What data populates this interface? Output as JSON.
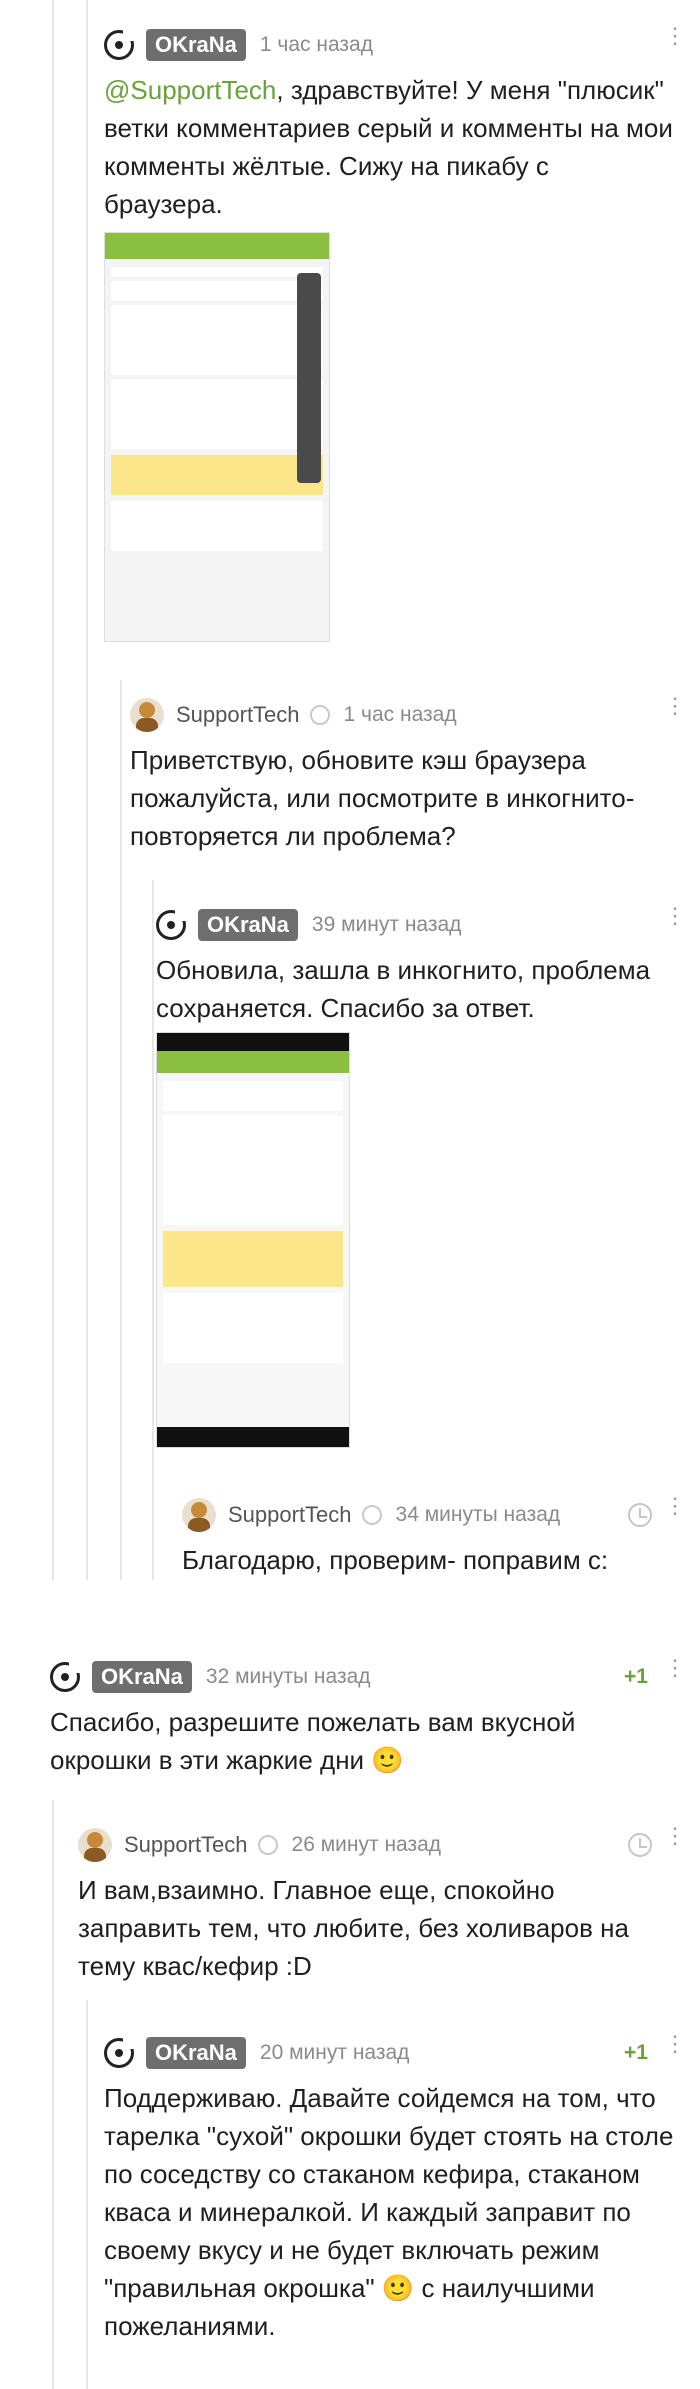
{
  "comments": [
    {
      "author": "OKraNa",
      "time": "1 час назад",
      "mention": "@SupportTech",
      "text": ", здравствуйте! У меня \"плюсик\" ветки комментариев серый и комменты на мои комменты жёлтые. Сижу на пикабу с браузера."
    },
    {
      "author": "SupportTech",
      "time": "1 час назад",
      "text": "Приветствую, обновите кэш браузера пожалуйста, или посмотрите в инкогнито- повторяется ли проблема?"
    },
    {
      "author": "OKraNa",
      "time": "39 минут назад",
      "text": "Обновила, зашла в инкогнито, проблема сохраняется. Спасибо за ответ."
    },
    {
      "author": "SupportTech",
      "time": "34 минуты назад",
      "text": "Благодарю, проверим- поправим с:"
    },
    {
      "author": "OKraNa",
      "time": "32 минуты назад",
      "rating": "+1",
      "text": "Спасибо, разрешите пожелать вам вкусной окрошки в эти жаркие дни 🙂"
    },
    {
      "author": "SupportTech",
      "time": "26 минут назад",
      "text": "И вам,взаимно. Главное еще, спокойно заправить тем, что любите, без холиваров на тему квас/кефир :D"
    },
    {
      "author": "OKraNa",
      "time": "20 минут назад",
      "rating": "+1",
      "text": "Поддерживаю. Давайте сойдемся на том, что тарелка \"сухой\" окрошки будет стоять на столе по соседству со стаканом кефира, стаканом кваса и минералкой. И каждый заправит по своему вкусу и не будет включать режим \"правильная окрошка\" 🙂 с наилучшими пожеланиями."
    }
  ],
  "more_glyph": "⋮",
  "icons": {
    "logo": "pikabu-logo-icon",
    "avatar": "support-avatar-icon",
    "verified": "verified-icon",
    "clock": "clock-icon"
  }
}
